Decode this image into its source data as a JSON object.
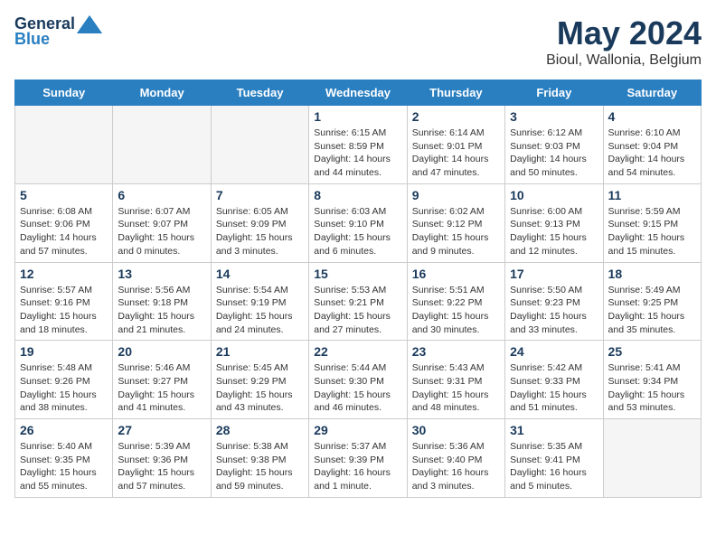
{
  "logo": {
    "line1": "General",
    "line2": "Blue"
  },
  "title": "May 2024",
  "subtitle": "Bioul, Wallonia, Belgium",
  "weekdays": [
    "Sunday",
    "Monday",
    "Tuesday",
    "Wednesday",
    "Thursday",
    "Friday",
    "Saturday"
  ],
  "weeks": [
    [
      {
        "day": "",
        "info": ""
      },
      {
        "day": "",
        "info": ""
      },
      {
        "day": "",
        "info": ""
      },
      {
        "day": "1",
        "info": "Sunrise: 6:15 AM\nSunset: 8:59 PM\nDaylight: 14 hours\nand 44 minutes."
      },
      {
        "day": "2",
        "info": "Sunrise: 6:14 AM\nSunset: 9:01 PM\nDaylight: 14 hours\nand 47 minutes."
      },
      {
        "day": "3",
        "info": "Sunrise: 6:12 AM\nSunset: 9:03 PM\nDaylight: 14 hours\nand 50 minutes."
      },
      {
        "day": "4",
        "info": "Sunrise: 6:10 AM\nSunset: 9:04 PM\nDaylight: 14 hours\nand 54 minutes."
      }
    ],
    [
      {
        "day": "5",
        "info": "Sunrise: 6:08 AM\nSunset: 9:06 PM\nDaylight: 14 hours\nand 57 minutes."
      },
      {
        "day": "6",
        "info": "Sunrise: 6:07 AM\nSunset: 9:07 PM\nDaylight: 15 hours\nand 0 minutes."
      },
      {
        "day": "7",
        "info": "Sunrise: 6:05 AM\nSunset: 9:09 PM\nDaylight: 15 hours\nand 3 minutes."
      },
      {
        "day": "8",
        "info": "Sunrise: 6:03 AM\nSunset: 9:10 PM\nDaylight: 15 hours\nand 6 minutes."
      },
      {
        "day": "9",
        "info": "Sunrise: 6:02 AM\nSunset: 9:12 PM\nDaylight: 15 hours\nand 9 minutes."
      },
      {
        "day": "10",
        "info": "Sunrise: 6:00 AM\nSunset: 9:13 PM\nDaylight: 15 hours\nand 12 minutes."
      },
      {
        "day": "11",
        "info": "Sunrise: 5:59 AM\nSunset: 9:15 PM\nDaylight: 15 hours\nand 15 minutes."
      }
    ],
    [
      {
        "day": "12",
        "info": "Sunrise: 5:57 AM\nSunset: 9:16 PM\nDaylight: 15 hours\nand 18 minutes."
      },
      {
        "day": "13",
        "info": "Sunrise: 5:56 AM\nSunset: 9:18 PM\nDaylight: 15 hours\nand 21 minutes."
      },
      {
        "day": "14",
        "info": "Sunrise: 5:54 AM\nSunset: 9:19 PM\nDaylight: 15 hours\nand 24 minutes."
      },
      {
        "day": "15",
        "info": "Sunrise: 5:53 AM\nSunset: 9:21 PM\nDaylight: 15 hours\nand 27 minutes."
      },
      {
        "day": "16",
        "info": "Sunrise: 5:51 AM\nSunset: 9:22 PM\nDaylight: 15 hours\nand 30 minutes."
      },
      {
        "day": "17",
        "info": "Sunrise: 5:50 AM\nSunset: 9:23 PM\nDaylight: 15 hours\nand 33 minutes."
      },
      {
        "day": "18",
        "info": "Sunrise: 5:49 AM\nSunset: 9:25 PM\nDaylight: 15 hours\nand 35 minutes."
      }
    ],
    [
      {
        "day": "19",
        "info": "Sunrise: 5:48 AM\nSunset: 9:26 PM\nDaylight: 15 hours\nand 38 minutes."
      },
      {
        "day": "20",
        "info": "Sunrise: 5:46 AM\nSunset: 9:27 PM\nDaylight: 15 hours\nand 41 minutes."
      },
      {
        "day": "21",
        "info": "Sunrise: 5:45 AM\nSunset: 9:29 PM\nDaylight: 15 hours\nand 43 minutes."
      },
      {
        "day": "22",
        "info": "Sunrise: 5:44 AM\nSunset: 9:30 PM\nDaylight: 15 hours\nand 46 minutes."
      },
      {
        "day": "23",
        "info": "Sunrise: 5:43 AM\nSunset: 9:31 PM\nDaylight: 15 hours\nand 48 minutes."
      },
      {
        "day": "24",
        "info": "Sunrise: 5:42 AM\nSunset: 9:33 PM\nDaylight: 15 hours\nand 51 minutes."
      },
      {
        "day": "25",
        "info": "Sunrise: 5:41 AM\nSunset: 9:34 PM\nDaylight: 15 hours\nand 53 minutes."
      }
    ],
    [
      {
        "day": "26",
        "info": "Sunrise: 5:40 AM\nSunset: 9:35 PM\nDaylight: 15 hours\nand 55 minutes."
      },
      {
        "day": "27",
        "info": "Sunrise: 5:39 AM\nSunset: 9:36 PM\nDaylight: 15 hours\nand 57 minutes."
      },
      {
        "day": "28",
        "info": "Sunrise: 5:38 AM\nSunset: 9:38 PM\nDaylight: 15 hours\nand 59 minutes."
      },
      {
        "day": "29",
        "info": "Sunrise: 5:37 AM\nSunset: 9:39 PM\nDaylight: 16 hours\nand 1 minute."
      },
      {
        "day": "30",
        "info": "Sunrise: 5:36 AM\nSunset: 9:40 PM\nDaylight: 16 hours\nand 3 minutes."
      },
      {
        "day": "31",
        "info": "Sunrise: 5:35 AM\nSunset: 9:41 PM\nDaylight: 16 hours\nand 5 minutes."
      },
      {
        "day": "",
        "info": ""
      }
    ]
  ]
}
